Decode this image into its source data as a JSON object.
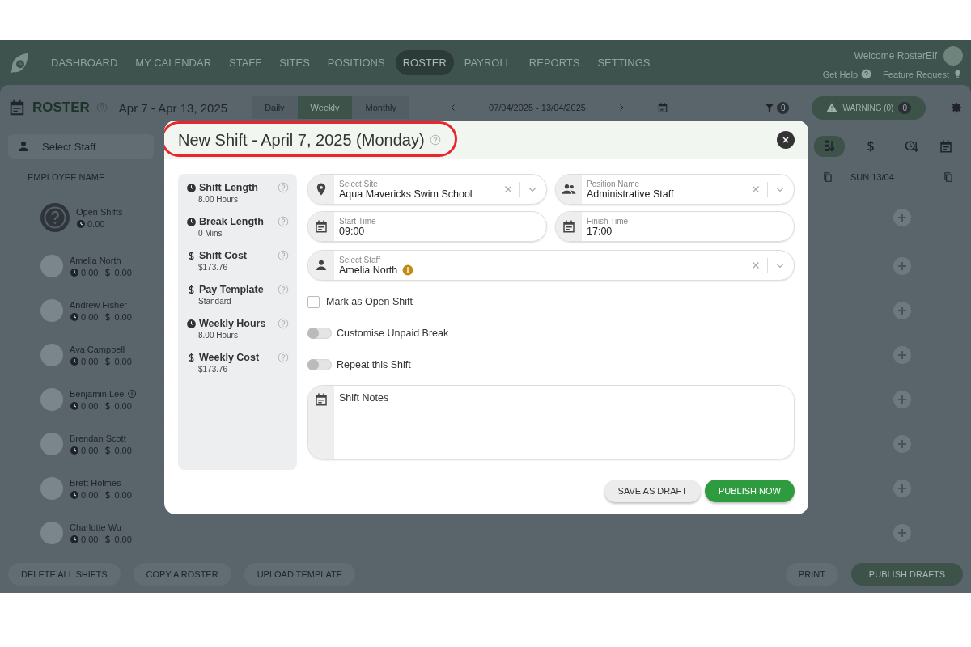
{
  "nav": {
    "items": [
      {
        "label": "DASHBOARD",
        "selected": false
      },
      {
        "label": "MY CALENDAR",
        "selected": false
      },
      {
        "label": "STAFF",
        "selected": false
      },
      {
        "label": "SITES",
        "selected": false
      },
      {
        "label": "POSITIONS",
        "selected": false
      },
      {
        "label": "ROSTER",
        "selected": true
      },
      {
        "label": "PAYROLL",
        "selected": false
      },
      {
        "label": "REPORTS",
        "selected": false
      },
      {
        "label": "SETTINGS",
        "selected": false
      }
    ],
    "welcome": "Welcome RosterElf",
    "help_links": [
      {
        "label": "Get Help",
        "kind": "help"
      },
      {
        "label": "Feature Request",
        "kind": "idea"
      }
    ]
  },
  "toolbar": {
    "title": "ROSTER",
    "date_range": "Apr 7 - Apr 13, 2025",
    "view_tabs": [
      {
        "label": "Daily",
        "selected": false
      },
      {
        "label": "Weekly",
        "selected": true
      },
      {
        "label": "Monthly",
        "selected": false
      }
    ],
    "period": "07/04/2025 - 13/04/2025",
    "filter_count": "0",
    "warning": {
      "label": "WARNING (0)",
      "count": "0"
    }
  },
  "staff_filter": {
    "placeholder": "Select Staff"
  },
  "sort_options": [
    {
      "kind": "alpha",
      "selected": true
    },
    {
      "kind": "cost",
      "selected": false
    },
    {
      "kind": "time",
      "selected": false
    }
  ],
  "table": {
    "columns": [
      {
        "label": "EMPLOYEE NAME"
      },
      {
        "label": "SUN 13/04"
      }
    ],
    "rows": [
      {
        "kind": "open",
        "name": "Open Shifts",
        "hours": "0.00"
      },
      {
        "kind": "employee",
        "name": "Amelia North",
        "hours": "0.00",
        "cost": "0.00",
        "pay_flag": false
      },
      {
        "kind": "employee",
        "name": "Andrew Fisher",
        "hours": "0.00",
        "cost": "0.00",
        "pay_flag": false
      },
      {
        "kind": "employee",
        "name": "Ava Campbell",
        "hours": "0.00",
        "cost": "0.00",
        "pay_flag": false
      },
      {
        "kind": "employee",
        "name": "Benjamin Lee",
        "hours": "0.00",
        "cost": "0.00",
        "pay_flag": true
      },
      {
        "kind": "employee",
        "name": "Brendan Scott",
        "hours": "0.00",
        "cost": "0.00",
        "pay_flag": false
      },
      {
        "kind": "employee",
        "name": "Brett Holmes",
        "hours": "0.00",
        "cost": "0.00",
        "pay_flag": false
      },
      {
        "kind": "employee",
        "name": "Charlotte Wu",
        "hours": "0.00",
        "cost": "0.00",
        "pay_flag": false
      }
    ]
  },
  "footer_actions": [
    "DELETE ALL SHIFTS",
    "COPY A ROSTER",
    "UPLOAD TEMPLATE"
  ],
  "footer_right": [
    {
      "label": "PRINT",
      "kind": "plain"
    },
    {
      "label": "PUBLISH DRAFTS",
      "kind": "primary"
    }
  ],
  "modal": {
    "title": "New Shift - April 7, 2025 (Monday)",
    "summary": [
      {
        "kind": "clock",
        "label": "Shift Length",
        "value": "8.00 Hours"
      },
      {
        "kind": "clock",
        "label": "Break Length",
        "value": "0 Mins"
      },
      {
        "kind": "dollar",
        "label": "Shift Cost",
        "value": "$173.76"
      },
      {
        "kind": "dollar",
        "label": "Pay Template",
        "value": "Standard"
      },
      {
        "kind": "clock",
        "label": "Weekly Hours",
        "value": "8.00 Hours"
      },
      {
        "kind": "dollar",
        "label": "Weekly Cost",
        "value": "$173.76"
      }
    ],
    "fields": [
      {
        "kind": "site",
        "label": "Select Site",
        "value": "Aqua Mavericks Swim School",
        "clearable": true
      },
      {
        "kind": "people",
        "label": "Position Name",
        "value": "Administrative Staff",
        "clearable": true
      },
      {
        "kind": "time",
        "label": "Start Time",
        "value": "09:00",
        "clearable": false
      },
      {
        "kind": "time",
        "label": "Finish Time",
        "value": "17:00",
        "clearable": false
      }
    ],
    "staff": {
      "label": "Select Staff",
      "value": "Amelia North",
      "clearable": true
    },
    "open_shift": {
      "label": "Mark as Open Shift",
      "checked": false
    },
    "toggles": [
      {
        "label": "Customise Unpaid Break",
        "on": false
      },
      {
        "label": "Repeat this Shift",
        "on": false
      }
    ],
    "notes": {
      "placeholder": "Shift Notes"
    },
    "buttons": [
      {
        "label": "SAVE AS DRAFT",
        "kind": "secondary"
      },
      {
        "label": "PUBLISH NOW",
        "kind": "primary"
      }
    ]
  }
}
